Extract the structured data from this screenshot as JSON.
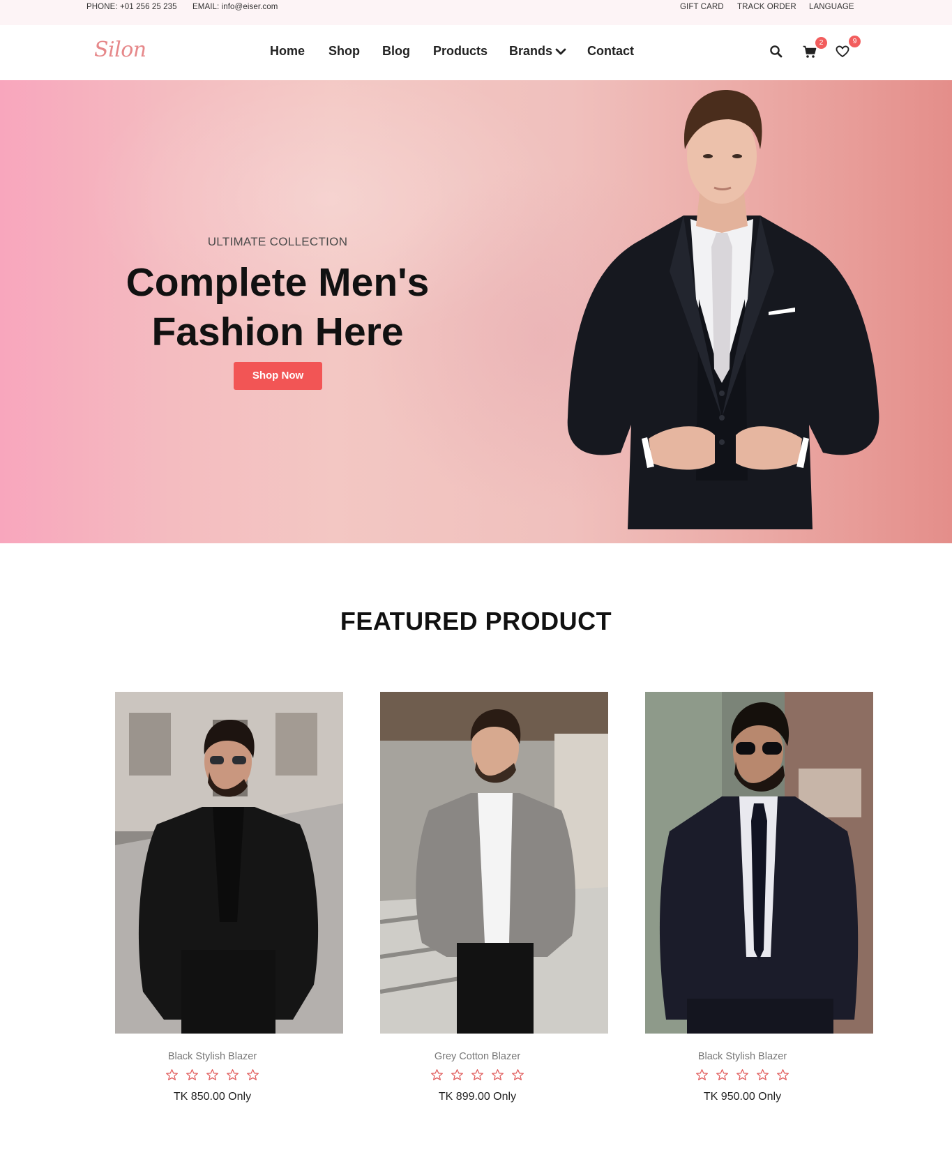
{
  "topbar": {
    "phone": "PHONE: +01 256 25 235",
    "email": "EMAIL: info@eiser.com",
    "links": [
      "GIFT CARD",
      "TRACK ORDER",
      "LANGUAGE"
    ]
  },
  "header": {
    "logo": "Silon",
    "nav": [
      "Home",
      "Shop",
      "Blog",
      "Products",
      "Brands",
      "Contact"
    ],
    "cart_count": "2",
    "wishlist_count": "9",
    "icons": [
      "search-icon",
      "cart-icon",
      "heart-icon",
      "chevron-down-icon"
    ]
  },
  "hero": {
    "subtitle": "ULTIMATE COLLECTION",
    "title_line1": "Complete Men's",
    "title_line2": "Fashion Here",
    "button": "Shop Now"
  },
  "featured": {
    "title": "FEATURED PRODUCT",
    "products": [
      {
        "name": "Black Stylish Blazer",
        "rating": 0,
        "max_rating": 5,
        "price": "TK 850.00 Only"
      },
      {
        "name": "Grey Cotton Blazer",
        "rating": 0,
        "max_rating": 5,
        "price": "TK 899.00 Only"
      },
      {
        "name": "Black Stylish Blazer",
        "rating": 0,
        "max_rating": 5,
        "price": "TK 950.00 Only"
      }
    ]
  },
  "colors": {
    "accent": "#f25555",
    "badge": "#f25d5d",
    "logo": "#e6888a",
    "topbar_bg": "#fdf4f6",
    "hero_left": "#f8a6bd",
    "hero_right": "#e48e8a"
  }
}
